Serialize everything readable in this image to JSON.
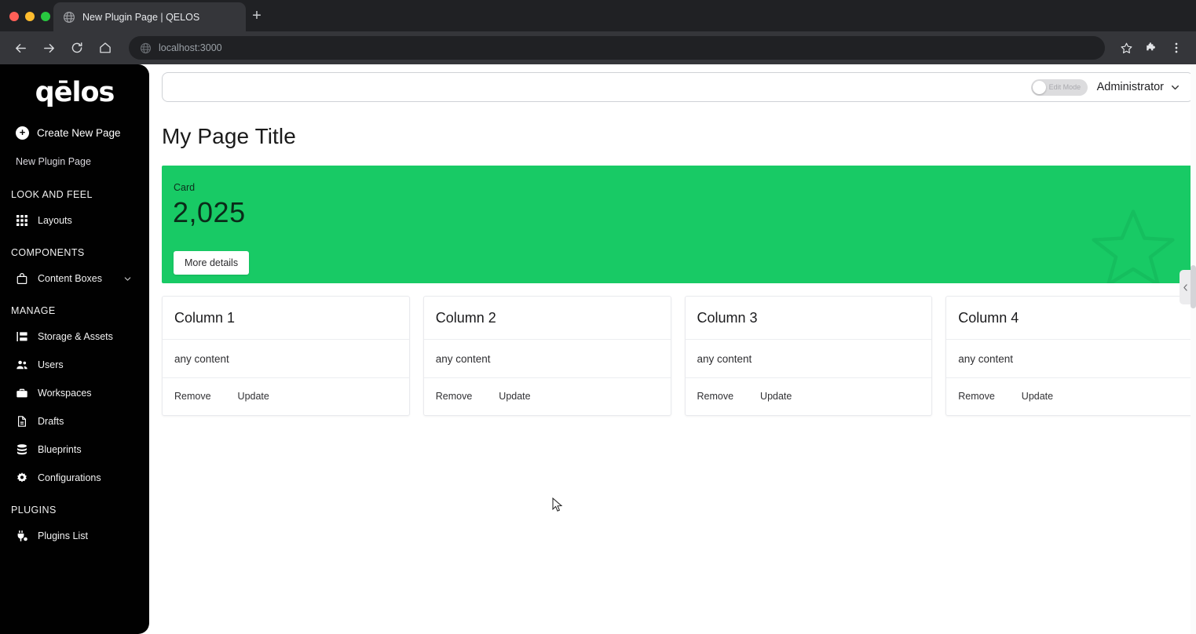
{
  "browser": {
    "tab": {
      "title": "New Plugin Page | QELOS",
      "favicon_icon": "globe-icon"
    },
    "new_tab_label": "+",
    "back_icon": "arrow-left-icon",
    "forward_icon": "arrow-right-icon",
    "reload_icon": "reload-icon",
    "home_icon": "home-icon",
    "omnibox": {
      "url": "localhost:3000",
      "site_icon": "globe-icon"
    },
    "bookmark_icon": "star-icon",
    "extensions_icon": "puzzle-icon",
    "menu_icon": "three-dots-vertical-icon",
    "traffic_lights": [
      "close-red",
      "minimize-yellow",
      "maximize-green"
    ]
  },
  "sidebar": {
    "logo": "qēlos",
    "create_new_page": {
      "label": "Create New Page",
      "icon": "plus-circle-icon"
    },
    "active_page": {
      "label": "New Plugin Page"
    },
    "groups": [
      {
        "title": "LOOK AND FEEL",
        "items": [
          {
            "label": "Layouts",
            "icon": "grid-icon",
            "chevron": false
          }
        ]
      },
      {
        "title": "COMPONENTS",
        "items": [
          {
            "label": "Content Boxes",
            "icon": "box-icon",
            "chevron": true
          }
        ]
      },
      {
        "title": "MANAGE",
        "items": [
          {
            "label": "Storage & Assets",
            "icon": "storage-icon",
            "chevron": false
          },
          {
            "label": "Users",
            "icon": "users-icon",
            "chevron": false
          },
          {
            "label": "Workspaces",
            "icon": "briefcase-icon",
            "chevron": false
          },
          {
            "label": "Drafts",
            "icon": "document-icon",
            "chevron": false
          },
          {
            "label": "Blueprints",
            "icon": "database-icon",
            "chevron": false
          },
          {
            "label": "Configurations",
            "icon": "gear-icon",
            "chevron": false
          }
        ]
      },
      {
        "title": "PLUGINS",
        "items": [
          {
            "label": "Plugins List",
            "icon": "plug-icon",
            "chevron": false
          }
        ]
      }
    ]
  },
  "topbar": {
    "edit_mode_label": "Edit Mode",
    "edit_mode_on": false,
    "user_name": "Administrator",
    "user_chevron_icon": "chevron-down-icon"
  },
  "page": {
    "title": "My Page Title"
  },
  "green_card": {
    "label": "Card",
    "value": "2,025",
    "button_label": "More details",
    "background_color": "#18ca65",
    "watermark_icon": "star-outline-icon"
  },
  "columns": [
    {
      "title": "Column 1",
      "content": "any content",
      "remove_label": "Remove",
      "update_label": "Update"
    },
    {
      "title": "Column 2",
      "content": "any content",
      "remove_label": "Remove",
      "update_label": "Update"
    },
    {
      "title": "Column 3",
      "content": "any content",
      "remove_label": "Remove",
      "update_label": "Update"
    },
    {
      "title": "Column 4",
      "content": "any content",
      "remove_label": "Remove",
      "update_label": "Update"
    }
  ],
  "collapse_handle": {
    "icon": "chevron-left-icon",
    "label": "‹"
  }
}
